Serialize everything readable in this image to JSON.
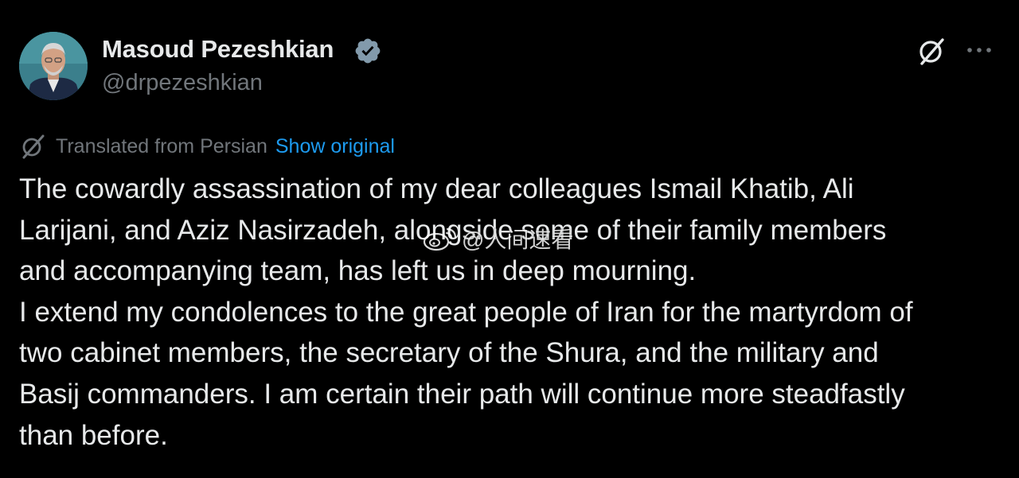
{
  "author": {
    "display_name": "Masoud Pezeshkian",
    "handle": "@drpezeshkian",
    "verified": true
  },
  "header_actions": {
    "grok_icon": "grok-slash-icon",
    "more_icon": "more-horizontal-icon"
  },
  "translation": {
    "label": "Translated from Persian",
    "show_original": "Show original",
    "icon": "translate-icon"
  },
  "tweet": {
    "lines": [
      "The cowardly assassination of my dear colleagues Ismail Khatib, Ali",
      "Larijani, and Aziz Nasirzadeh, alongside some of their family members",
      "and accompanying team, has left us in deep mourning.",
      "I extend my condolences to the great people of Iran for the martyrdom of",
      "two cabinet members, the secretary of the Shura, and the military and",
      "Basij commanders. I am certain their path will continue more steadfastly",
      "than before."
    ]
  },
  "watermark": {
    "text": "@人间速看",
    "icon": "weibo-icon"
  },
  "colors": {
    "background": "#000000",
    "primary_text": "#e7e9ea",
    "secondary_text": "#71767b",
    "link": "#1d9bf0",
    "verified_badge": "#829aab"
  }
}
